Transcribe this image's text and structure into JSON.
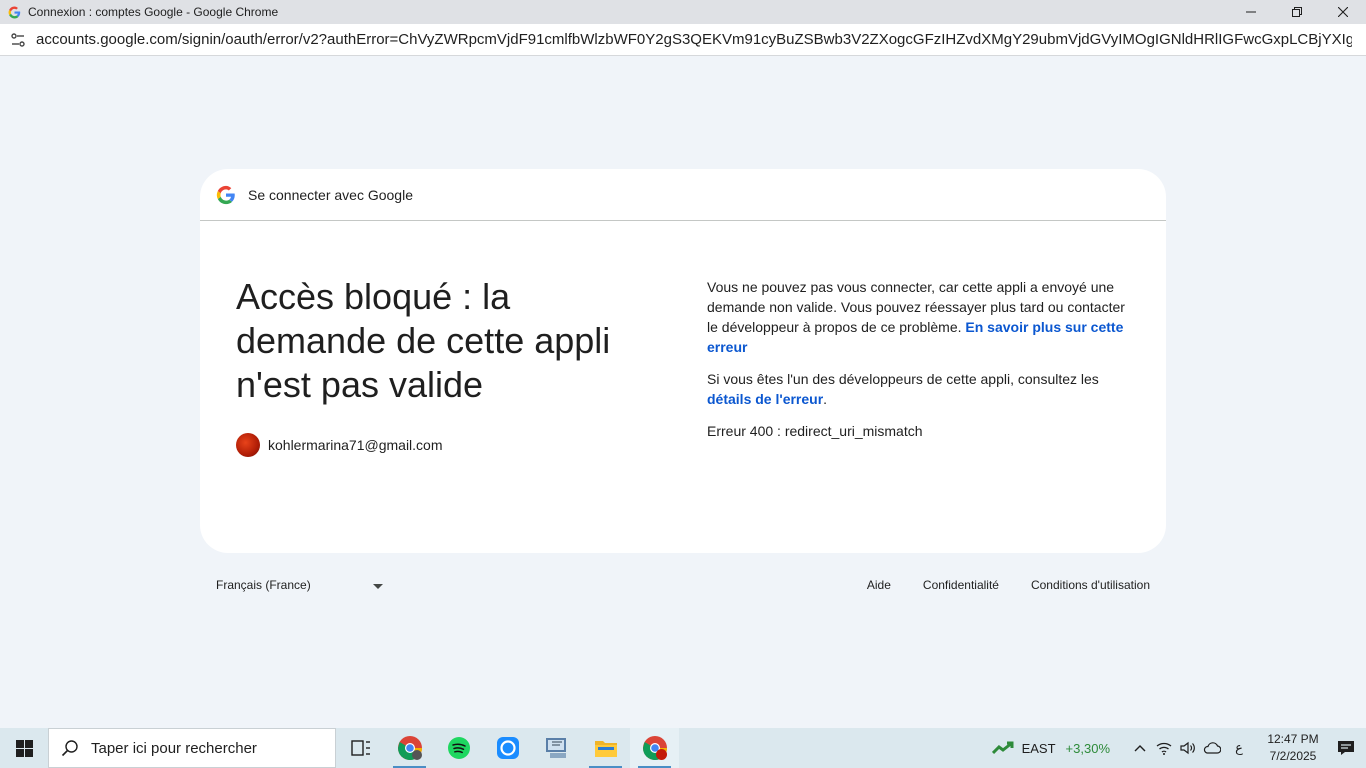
{
  "window": {
    "title": "Connexion : comptes Google - Google Chrome",
    "url": "accounts.google.com/signin/oauth/error/v2?authError=ChVyZWRpcmVjdF91cmlfbWlzbWF0Y2gS3QEKVm91cyBuZSBwb3V2ZXogcGFzIHZvdXMgY29ubmVjdGVyIMOgIGNldHRlIGFwcGxpLCBjYXIgZWxsZSBuZSBSByZ..."
  },
  "card": {
    "header": "Se connecter avec Google",
    "headline": "Accès bloqué : la demande de cette appli n'est pas valide",
    "email": "kohlermarina71@gmail.com",
    "para1_text": "Vous ne pouvez pas vous connecter, car cette appli a envoyé une demande non valide. Vous pouvez réessayer plus tard ou contacter le développeur à propos de ce problème. ",
    "para1_link": "En savoir plus sur cette erreur",
    "para2_text": "Si vous êtes l'un des développeurs de cette appli, consultez les ",
    "para2_link": "détails de l'erreur",
    "para2_end": ".",
    "error_code": "Erreur 400 : redirect_uri_mismatch"
  },
  "footer": {
    "language": "Français (France)",
    "links": [
      "Aide",
      "Confidentialité",
      "Conditions d'utilisation"
    ]
  },
  "taskbar": {
    "search_placeholder": "Taper ici pour rechercher",
    "stock_symbol": "EAST",
    "stock_change": "+3,30%",
    "lang_indicator": "ع",
    "time": "12:47 PM",
    "date": "7/2/2025"
  },
  "colors": {
    "link": "#0b57d0",
    "stock_up": "#2e8b3a",
    "page_bg": "#f0f4f9"
  }
}
